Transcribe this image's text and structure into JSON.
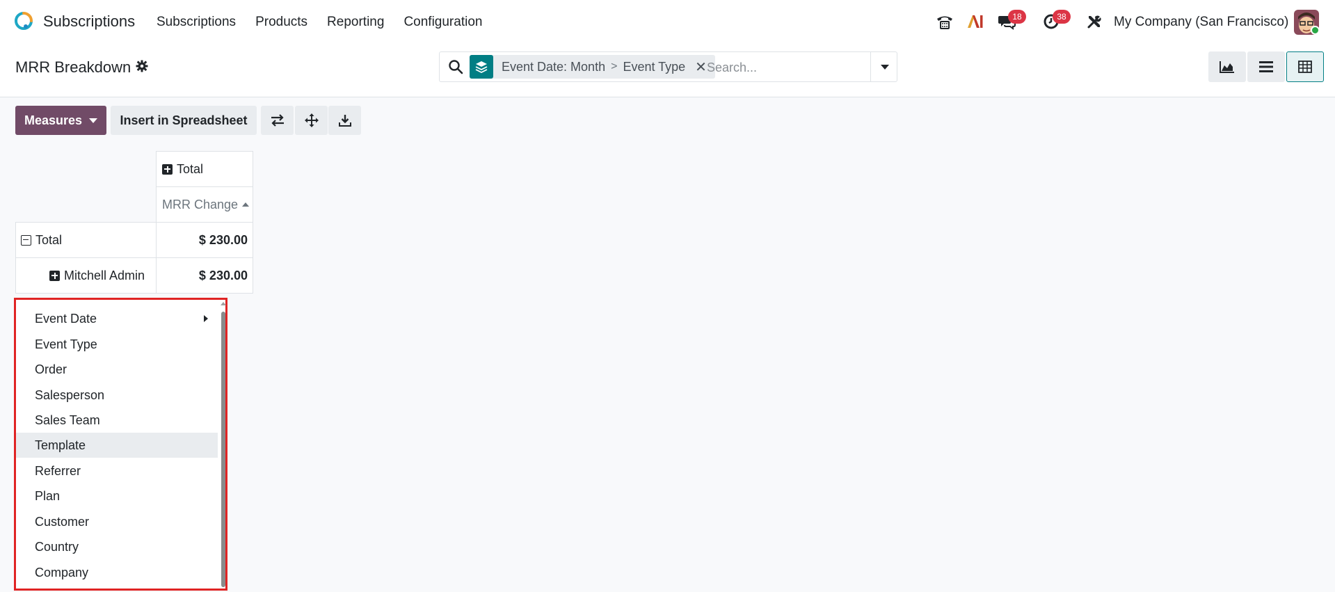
{
  "navbar": {
    "app_name": "Subscriptions",
    "menu": [
      "Subscriptions",
      "Products",
      "Reporting",
      "Configuration"
    ],
    "messages_count": "18",
    "activities_count": "38",
    "company": "My Company (San Francisco)",
    "icons": [
      "phone-icon",
      "ai-icon",
      "chat-icon",
      "clock-icon",
      "tools-icon"
    ]
  },
  "control_panel": {
    "title": "MRR Breakdown",
    "search": {
      "facet_left": "Event Date: Month",
      "facet_separator": ">",
      "facet_right": "Event Type",
      "placeholder": "Search..."
    },
    "views": [
      "graph-view",
      "list-view",
      "pivot-view"
    ],
    "active_view": "pivot-view"
  },
  "toolbar": {
    "measures_label": "Measures",
    "insert_label": "Insert in Spreadsheet"
  },
  "pivot": {
    "col_header": "Total",
    "measure": "MRR Change",
    "rows": [
      {
        "label": "Total",
        "value": "$ 230.00"
      },
      {
        "label": "Mitchell Admin",
        "value": "$ 230.00"
      }
    ]
  },
  "groupby_dropdown": {
    "items": [
      "Event Date",
      "Event Type",
      "Order",
      "Salesperson",
      "Sales Team",
      "Template",
      "Referrer",
      "Plan",
      "Customer",
      "Country",
      "Company"
    ],
    "highlighted": "Template"
  },
  "colors": {
    "brand": "#714b67",
    "accent": "#017e84",
    "badge": "#dc3545",
    "highlight_border": "#e02424"
  }
}
